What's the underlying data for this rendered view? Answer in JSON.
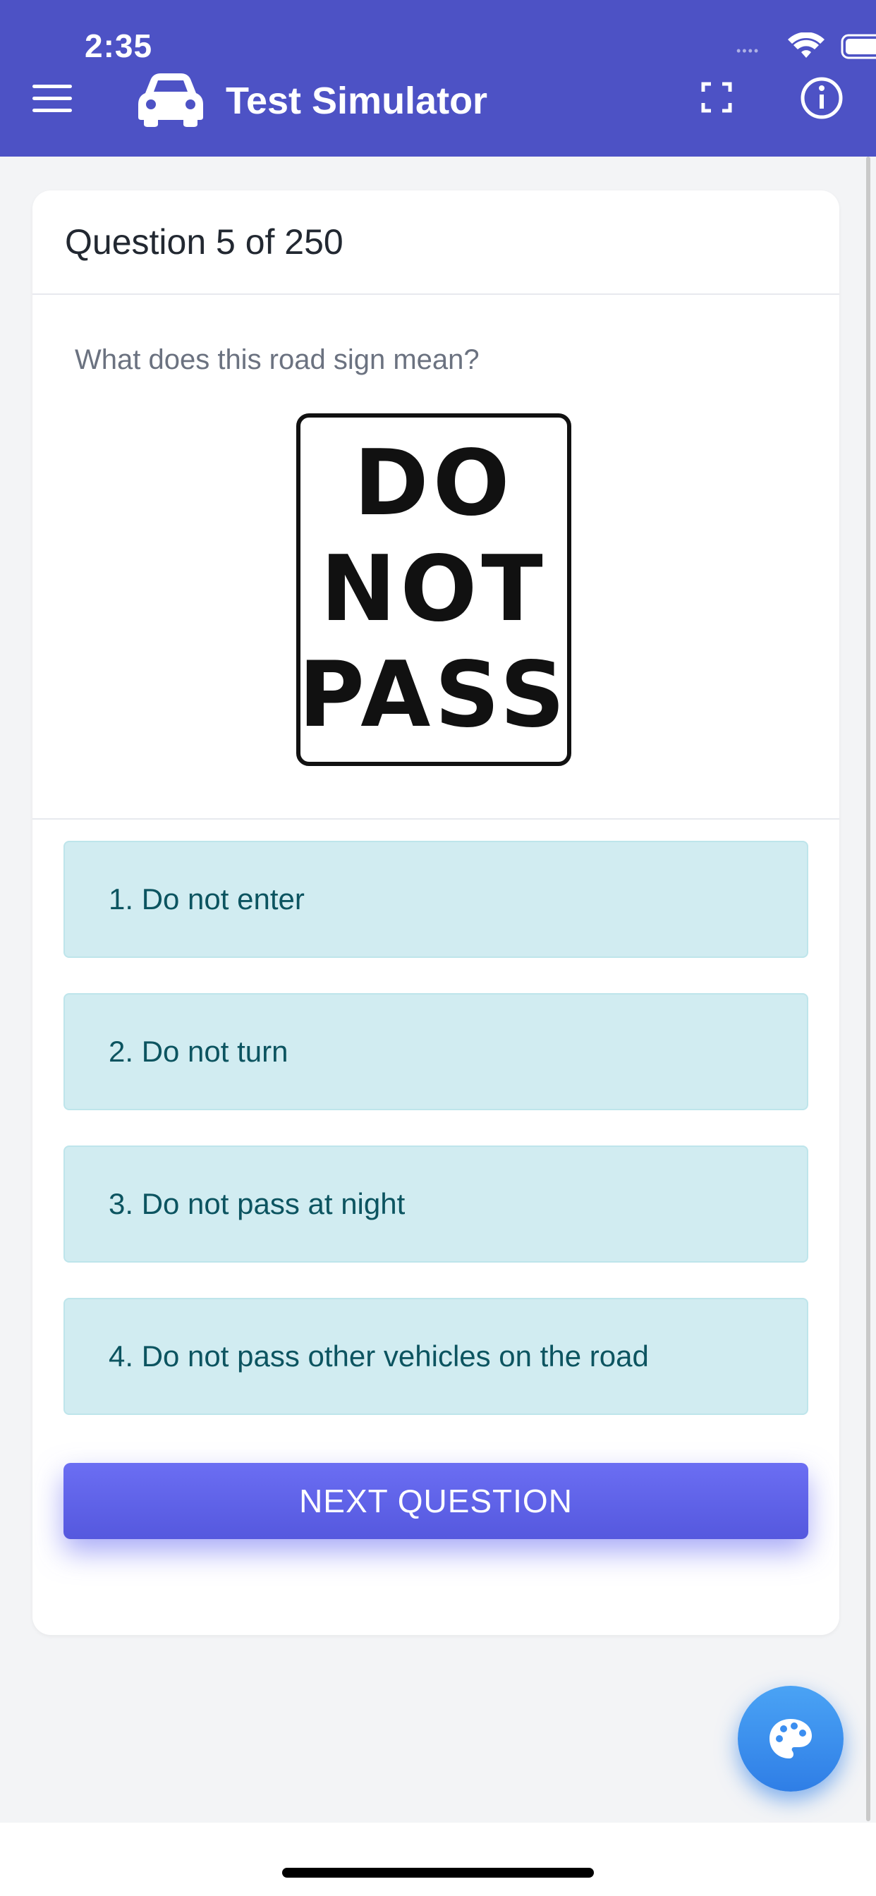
{
  "status_bar": {
    "time": "2:35"
  },
  "app_bar": {
    "title": "Test Simulator",
    "icons": [
      "menu-icon",
      "car-icon",
      "fullscreen-icon",
      "info-icon"
    ]
  },
  "quiz": {
    "counter": "Question 5 of 250",
    "question": "What does this road sign mean?",
    "sign_lines": [
      "DO",
      "NOT",
      "PASS"
    ],
    "answers": [
      "1. Do not enter",
      "2. Do not turn",
      "3. Do not pass at night",
      "4. Do not pass other vehicles on the road"
    ],
    "next_label": "NEXT QUESTION"
  },
  "fab": {
    "icon": "palette-icon"
  },
  "colors": {
    "app_bar": "#4d52c5",
    "answer_bg": "#d1ecf1",
    "answer_text": "#0c5460",
    "next_button": "#5f62ea",
    "fab": "#3b8ef0"
  }
}
